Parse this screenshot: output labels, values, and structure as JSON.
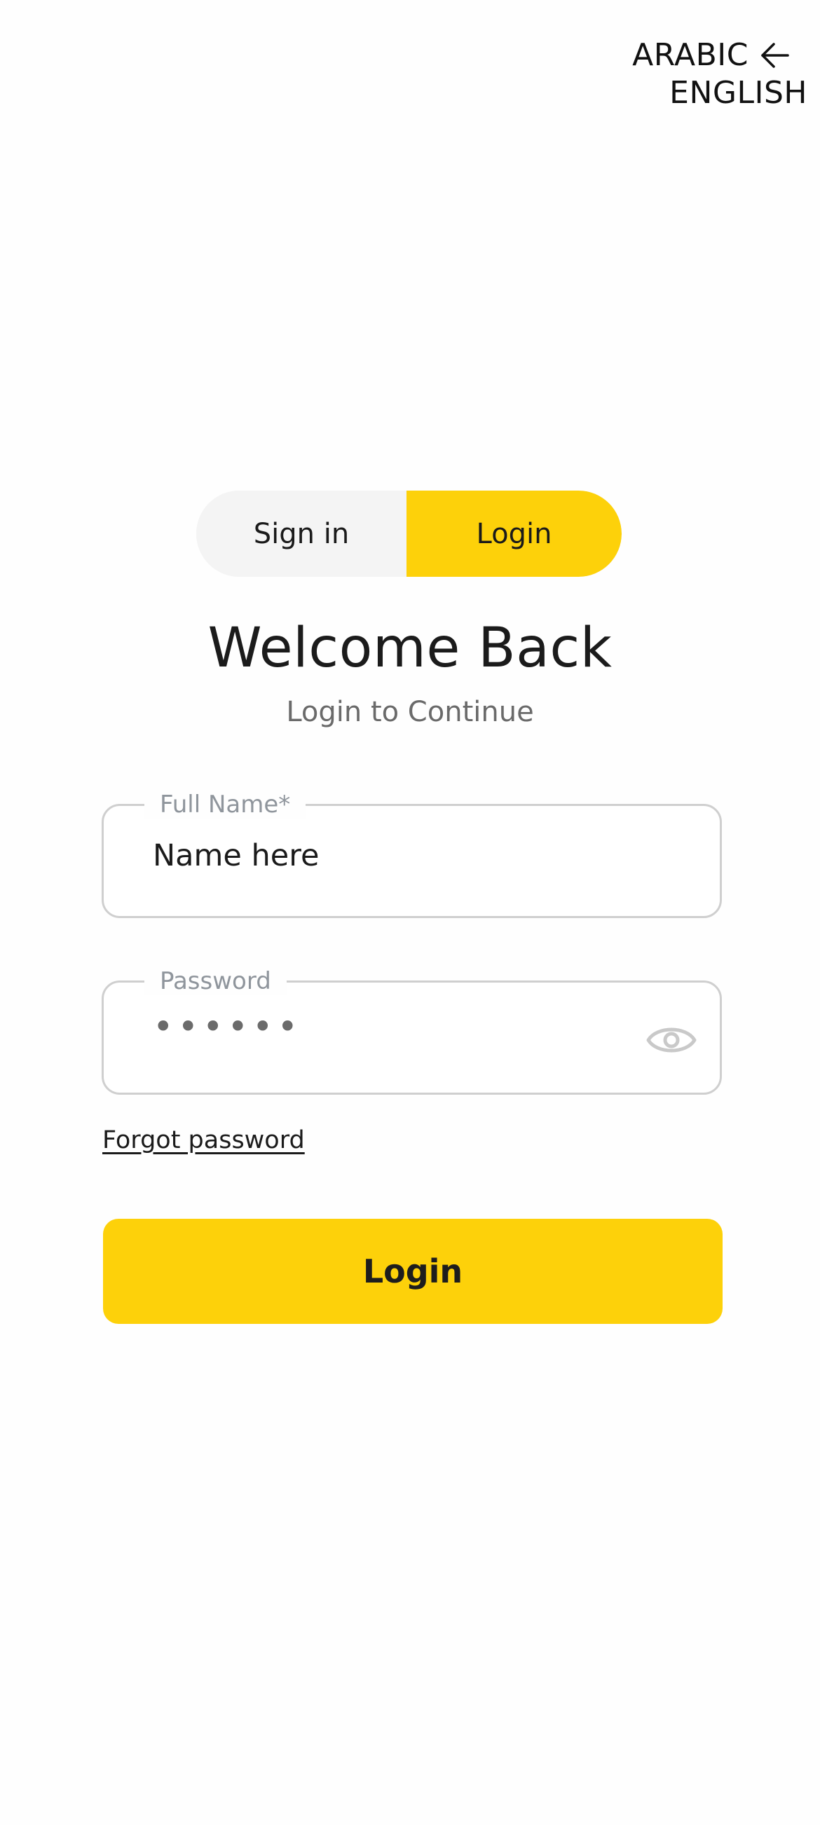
{
  "language_switch": {
    "current": "ARABIC",
    "target": "ENGLISH",
    "icon": "arrow-left-icon"
  },
  "tabs": {
    "signin_label": "Sign in",
    "login_label": "Login",
    "active": "Login"
  },
  "header": {
    "title": "Welcome Back",
    "subtitle": "Login to Continue"
  },
  "form": {
    "name_label": "Full Name*",
    "name_value": "Name here",
    "password_label": "Password",
    "password_value": "••••••",
    "password_toggle_icon": "eye-icon",
    "forgot_label": "Forgot password",
    "submit_label": "Login"
  },
  "colors": {
    "accent": "#fdd10a",
    "tab_inactive_bg": "#f4f4f4",
    "field_border": "#cfcfcf",
    "label_gray": "#8f959c"
  }
}
